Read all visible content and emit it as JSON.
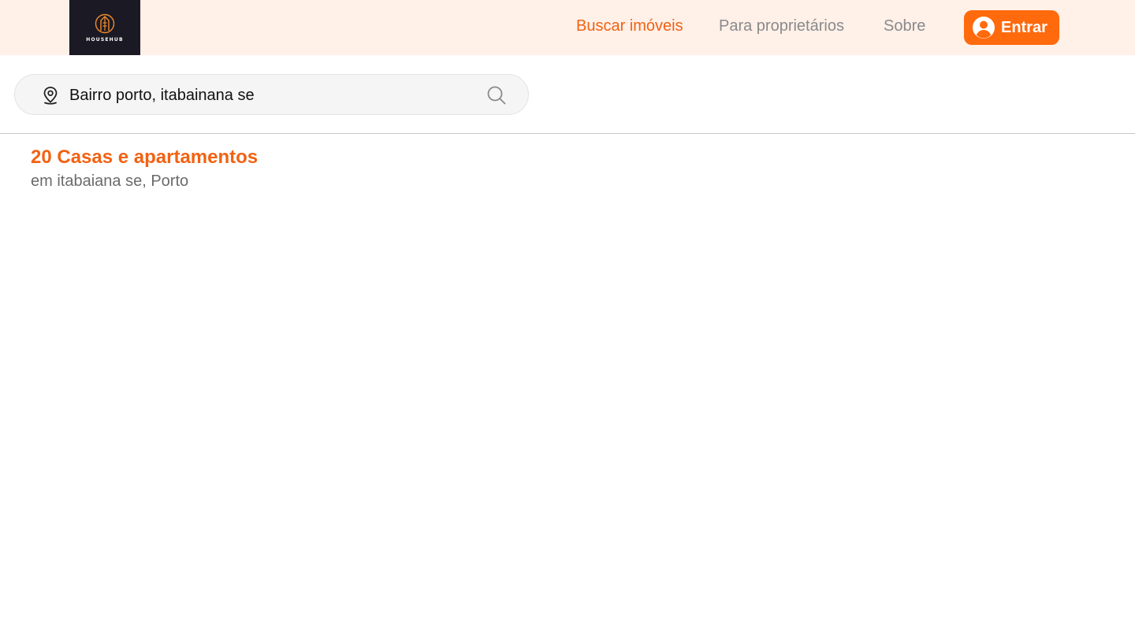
{
  "header": {
    "logo_text": "HOUSEHUB",
    "nav": [
      {
        "label": "Buscar imóveis",
        "active": true
      },
      {
        "label": "Para proprietários",
        "active": false
      },
      {
        "label": "Sobre",
        "active": false
      }
    ],
    "login_label": "Entrar",
    "login_icon": "user-circle-icon"
  },
  "search": {
    "value": "Bairro porto, itabainana se",
    "location_icon": "map-pin-icon",
    "search_icon": "search-icon"
  },
  "results": {
    "title": "20 Casas e apartamentos",
    "subtitle": "em itabaiana se, Porto"
  },
  "colors": {
    "accent": "#f26212",
    "button": "#ff6a0d",
    "header_bg": "#fff0e8",
    "logo_bg": "#1b1a24"
  }
}
